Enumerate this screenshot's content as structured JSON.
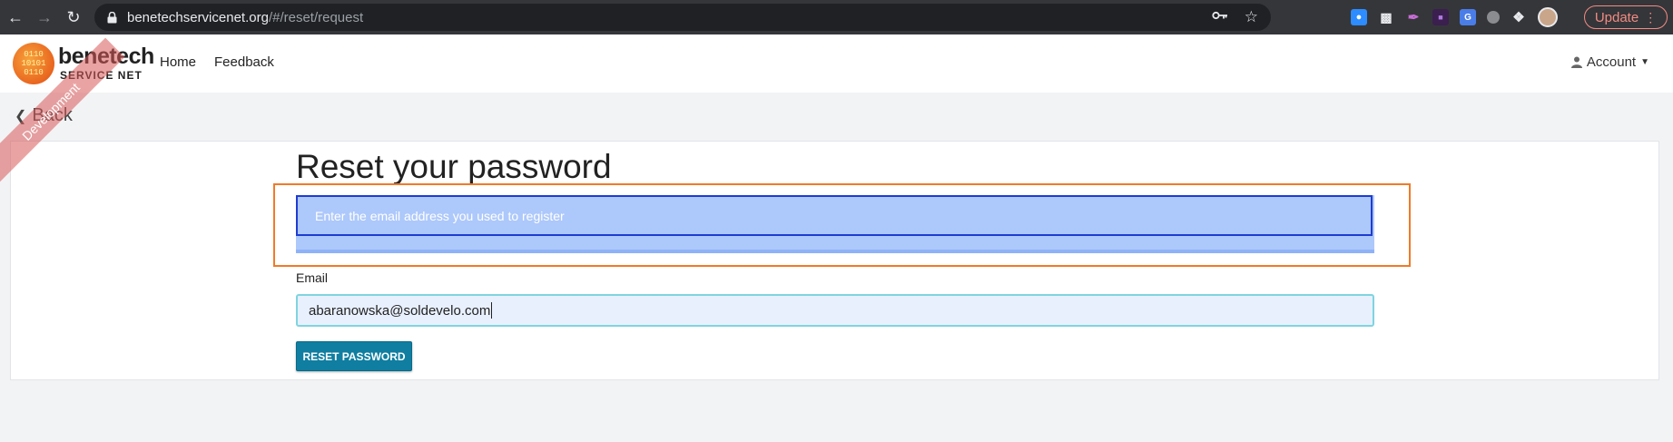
{
  "browser": {
    "url_host": "benetechservicenet.org",
    "url_path": "/#/reset/request",
    "update_label": "Update",
    "extensions": [
      "zoom-icon",
      "dark-mode-icon",
      "pen-icon",
      "hu-icon",
      "translate-icon",
      "circle-icon",
      "puzzle-icon"
    ]
  },
  "navbar": {
    "logo_line1": "benetech",
    "logo_line2": "SERVICE NET",
    "logo_bits": "0110\n10101\n0110",
    "links": [
      "Home",
      "Feedback"
    ],
    "account_label": "Account"
  },
  "ribbon": "Development",
  "back_label": "Back",
  "form": {
    "title": "Reset your password",
    "info_text": "Enter the email address you used to register",
    "email_label": "Email",
    "email_value": "abaranowska@soldevelo.com",
    "submit_label": "RESET PASSWORD"
  },
  "colors": {
    "primary_button": "#0f7ea1",
    "alert_bg": "#adc8fb",
    "highlight_border": "#f07a28",
    "update_accent": "#f28b82"
  }
}
